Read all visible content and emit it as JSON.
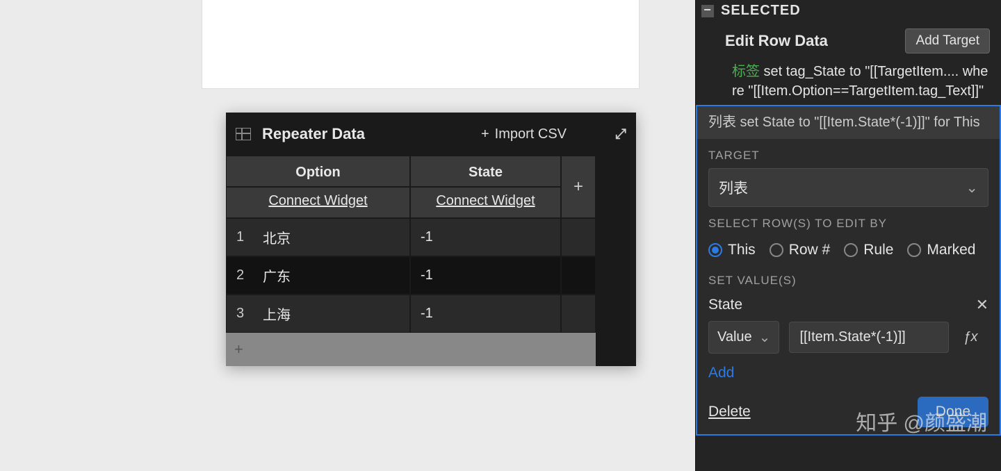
{
  "canvas": {},
  "repeater": {
    "title": "Repeater Data",
    "import_label": "Import CSV",
    "columns": {
      "option": "Option",
      "state": "State",
      "connect": "Connect Widget"
    },
    "rows": [
      {
        "index": "1",
        "option": "北京",
        "state": "-1"
      },
      {
        "index": "2",
        "option": "广东",
        "state": "-1"
      },
      {
        "index": "3",
        "option": "上海",
        "state": "-1"
      }
    ]
  },
  "panel": {
    "selected_label": "SELECTED",
    "edit_row_data": "Edit Row Data",
    "add_target": "Add Target",
    "action1": {
      "tag": "标签",
      "text": " set tag_State to \"[[TargetItem.... where \"[[Item.Option==TargetItem.tag_Text]]\""
    },
    "action2_summary": "列表 set State to \"[[Item.State*(-1)]]\" for This",
    "target_label": "TARGET",
    "target_value": "列表",
    "select_rows_label": "SELECT ROW(S) TO EDIT BY",
    "radios": {
      "this": "This",
      "rownum": "Row #",
      "rule": "Rule",
      "marked": "Marked"
    },
    "set_values_label": "SET VALUE(S)",
    "state_field": "State",
    "value_type_label": "Value",
    "value_expr": "[[Item.State*(-1)]]",
    "add_label": "Add",
    "delete_label": "Delete",
    "done_label": "Done"
  },
  "watermark": "知乎 @颜盛潮"
}
